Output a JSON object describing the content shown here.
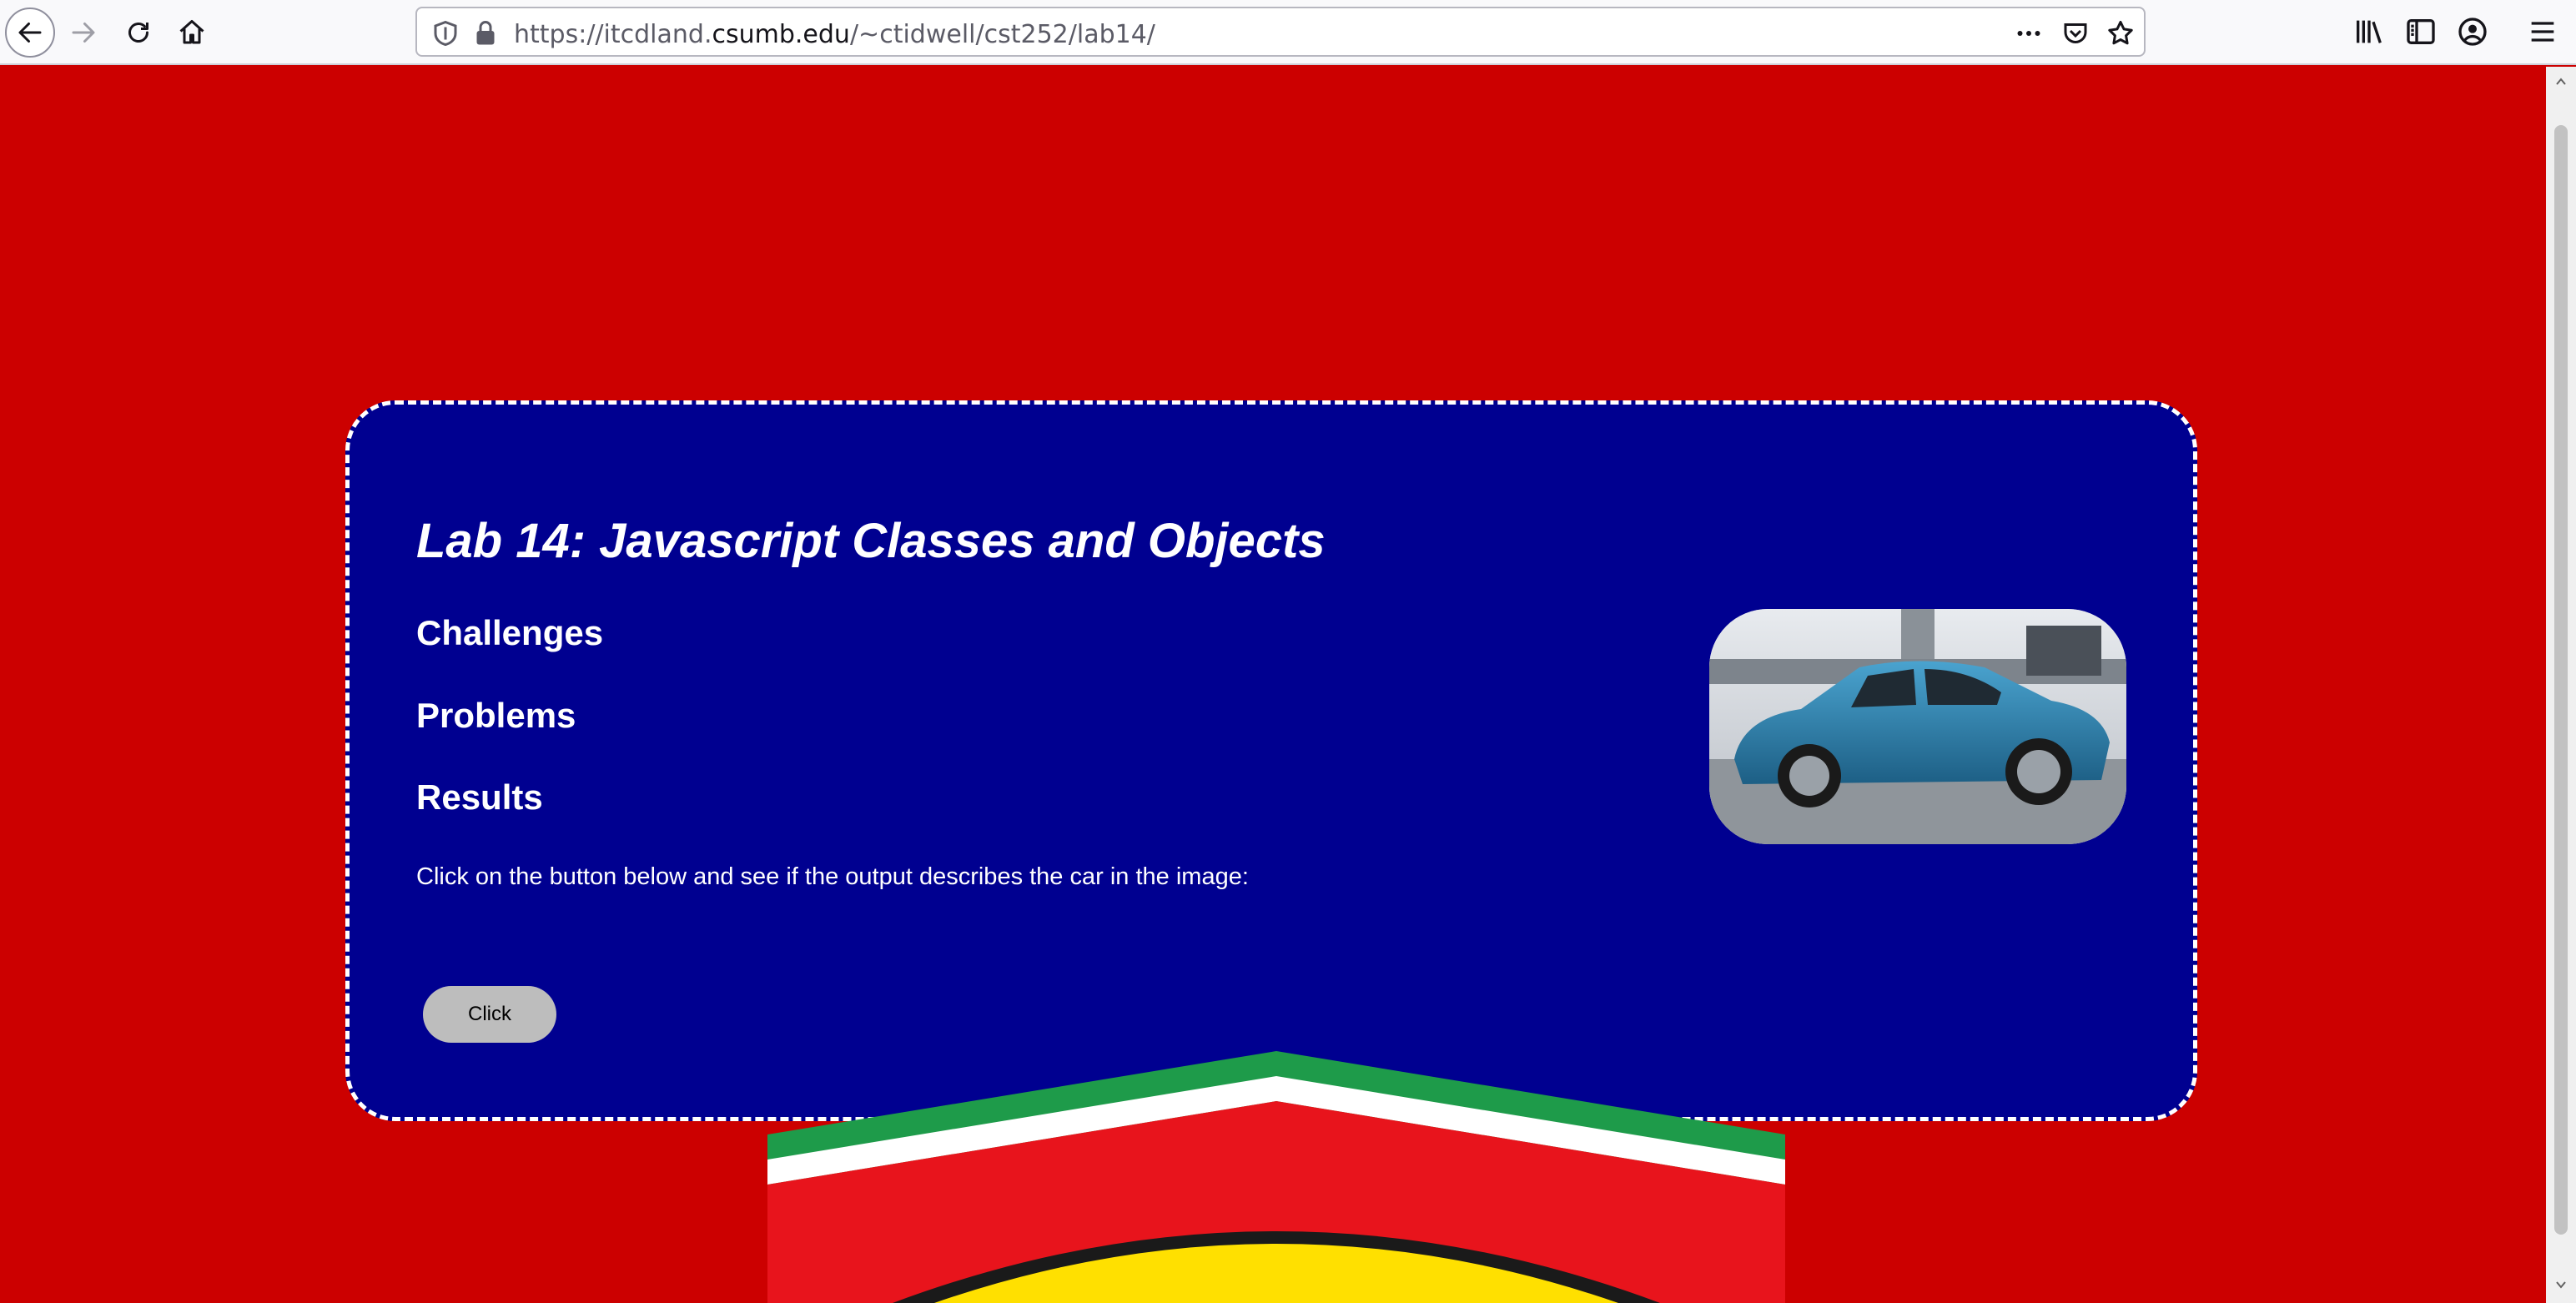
{
  "browser": {
    "url_prefix": "https://itcdland.",
    "url_domain": "csumb.edu",
    "url_path": "/~ctidwell/cst252/lab14/"
  },
  "page": {
    "title": "Lab 14: Javascript Classes and Objects",
    "sections": [
      "Challenges",
      "Problems",
      "Results"
    ],
    "instruction": "Click on the button below and see if the output describes the car in the image:",
    "button_label": "Click"
  },
  "colors": {
    "page_background": "#cc0000",
    "card_background": "#000090",
    "card_border": "#ffffff",
    "button": "#bdbdbd"
  }
}
